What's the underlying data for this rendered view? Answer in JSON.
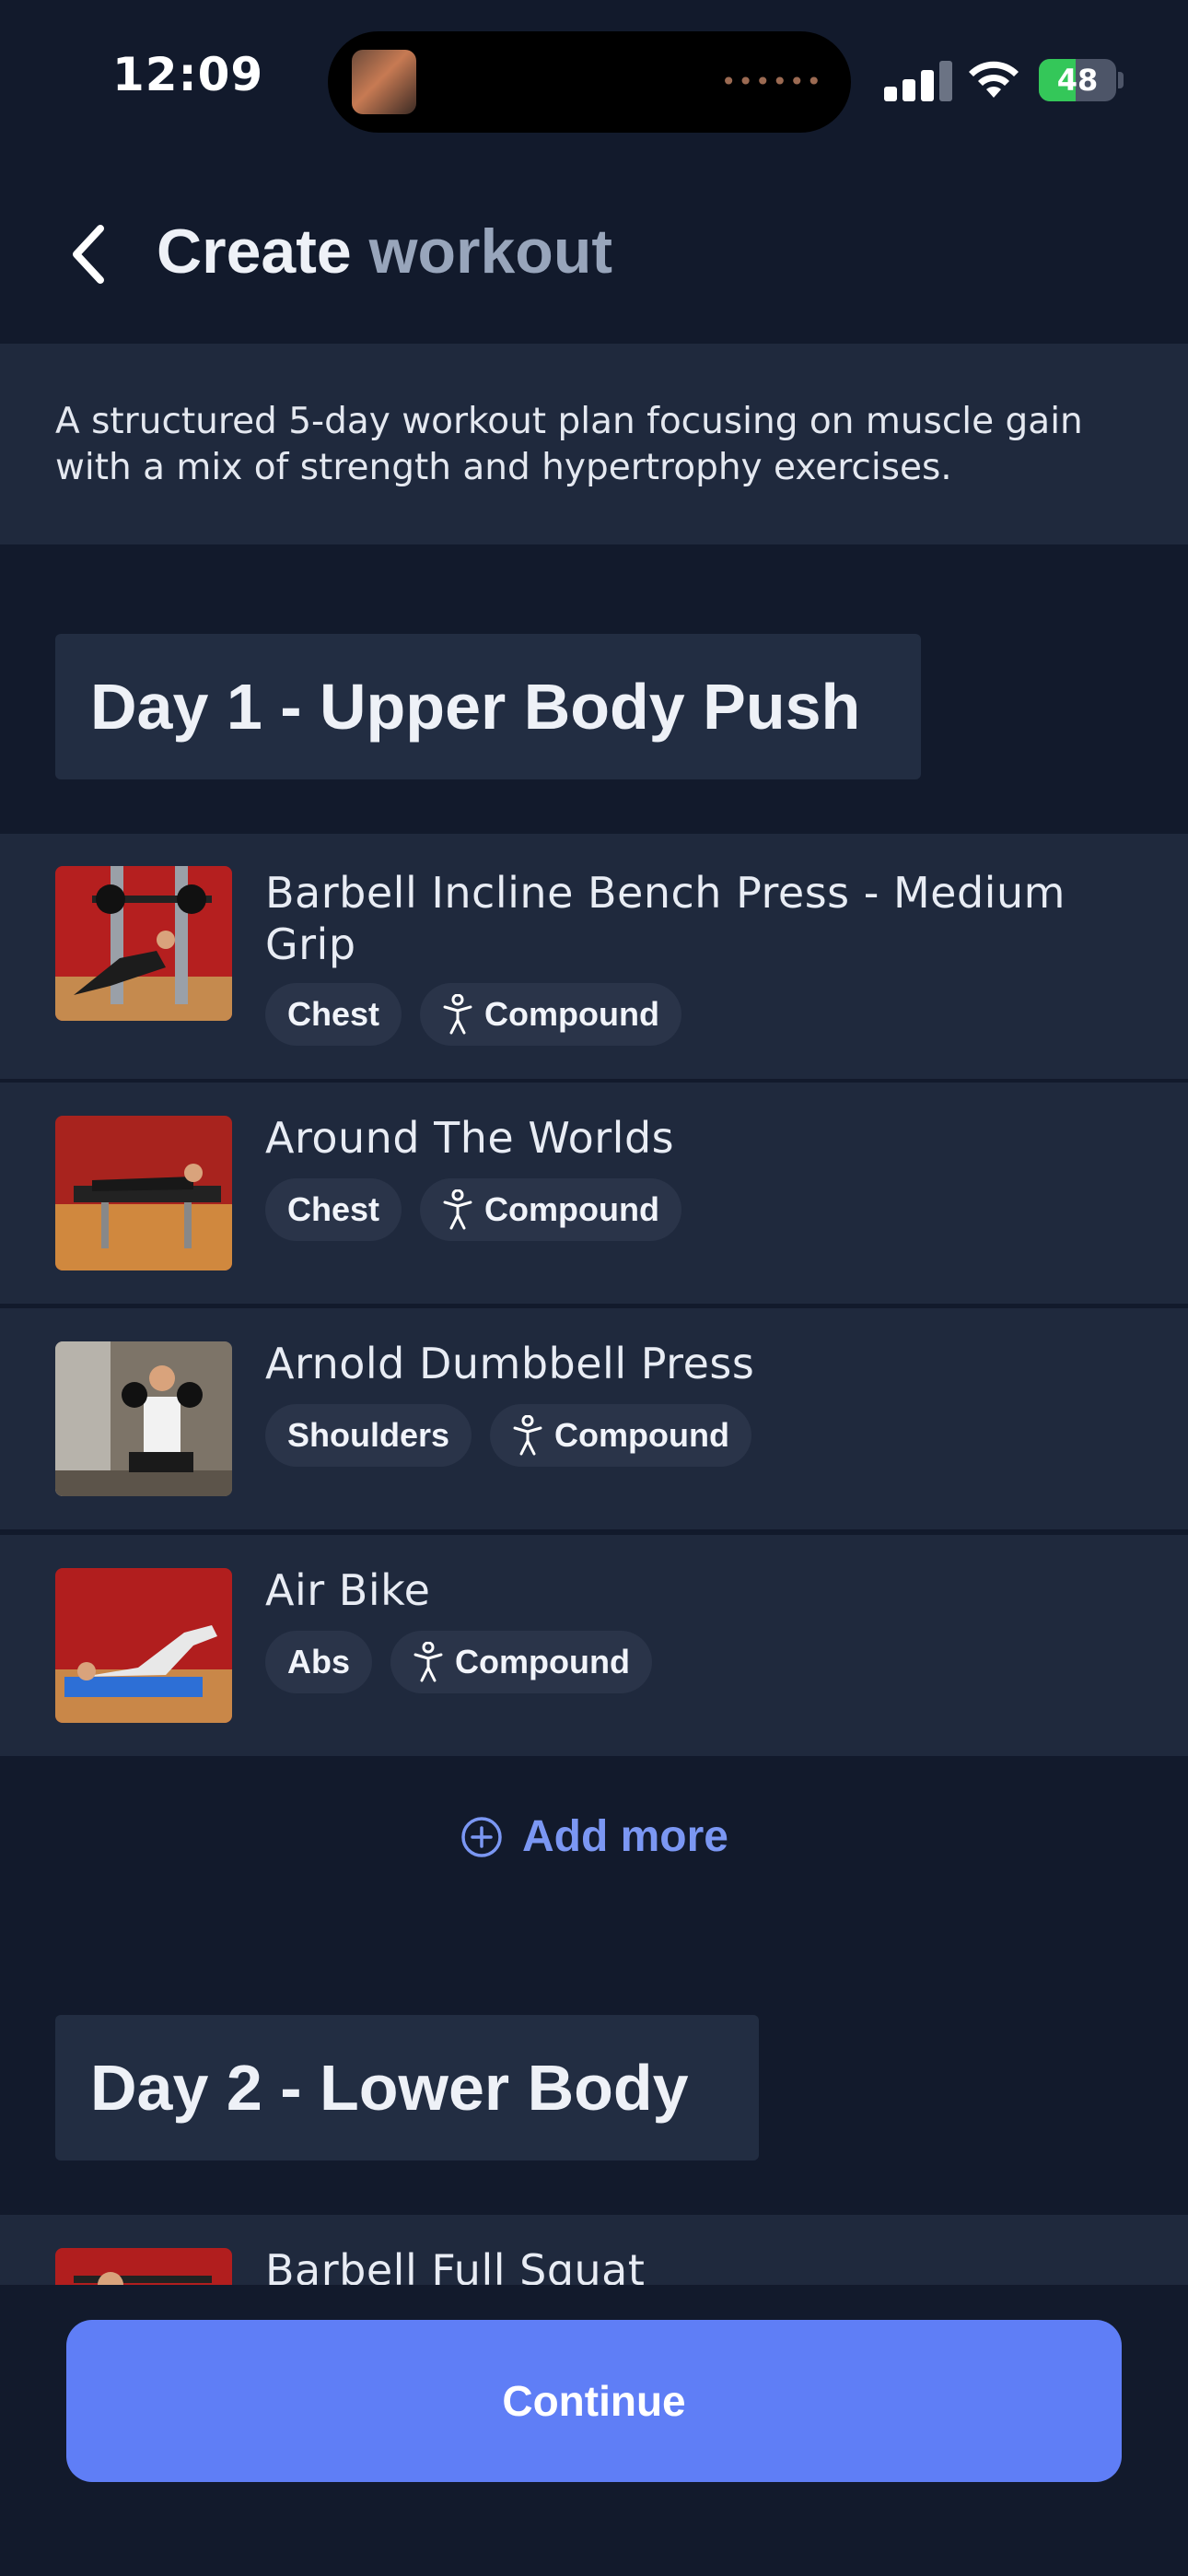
{
  "status_bar": {
    "time": "12:09",
    "battery": "48"
  },
  "header": {
    "title_part1": "Create",
    "title_part2": "workout"
  },
  "description": "A structured 5-day workout plan focusing on muscle gain with a mix of strength and hypertrophy exercises.",
  "days": [
    {
      "title": "Day 1 - Upper Body Push",
      "exercises": [
        {
          "name": "Barbell Incline Bench Press - Medium Grip",
          "muscle": "Chest",
          "type": "Compound"
        },
        {
          "name": "Around The Worlds",
          "muscle": "Chest",
          "type": "Compound"
        },
        {
          "name": "Arnold Dumbbell Press",
          "muscle": "Shoulders",
          "type": "Compound"
        },
        {
          "name": "Air Bike",
          "muscle": "Abs",
          "type": "Compound"
        }
      ],
      "add_more_label": "Add more"
    },
    {
      "title": "Day 2 - Lower Body",
      "exercises": [
        {
          "name": "Barbell Full Squat"
        }
      ]
    }
  ],
  "continue_label": "Continue",
  "icons": {
    "back": "chevron-left-icon",
    "compound": "person-icon",
    "add": "plus-circle-icon"
  },
  "colors": {
    "background": "#121a2c",
    "card": "#1f293d",
    "accent": "#5f7ef6",
    "link": "#7b97f3"
  }
}
